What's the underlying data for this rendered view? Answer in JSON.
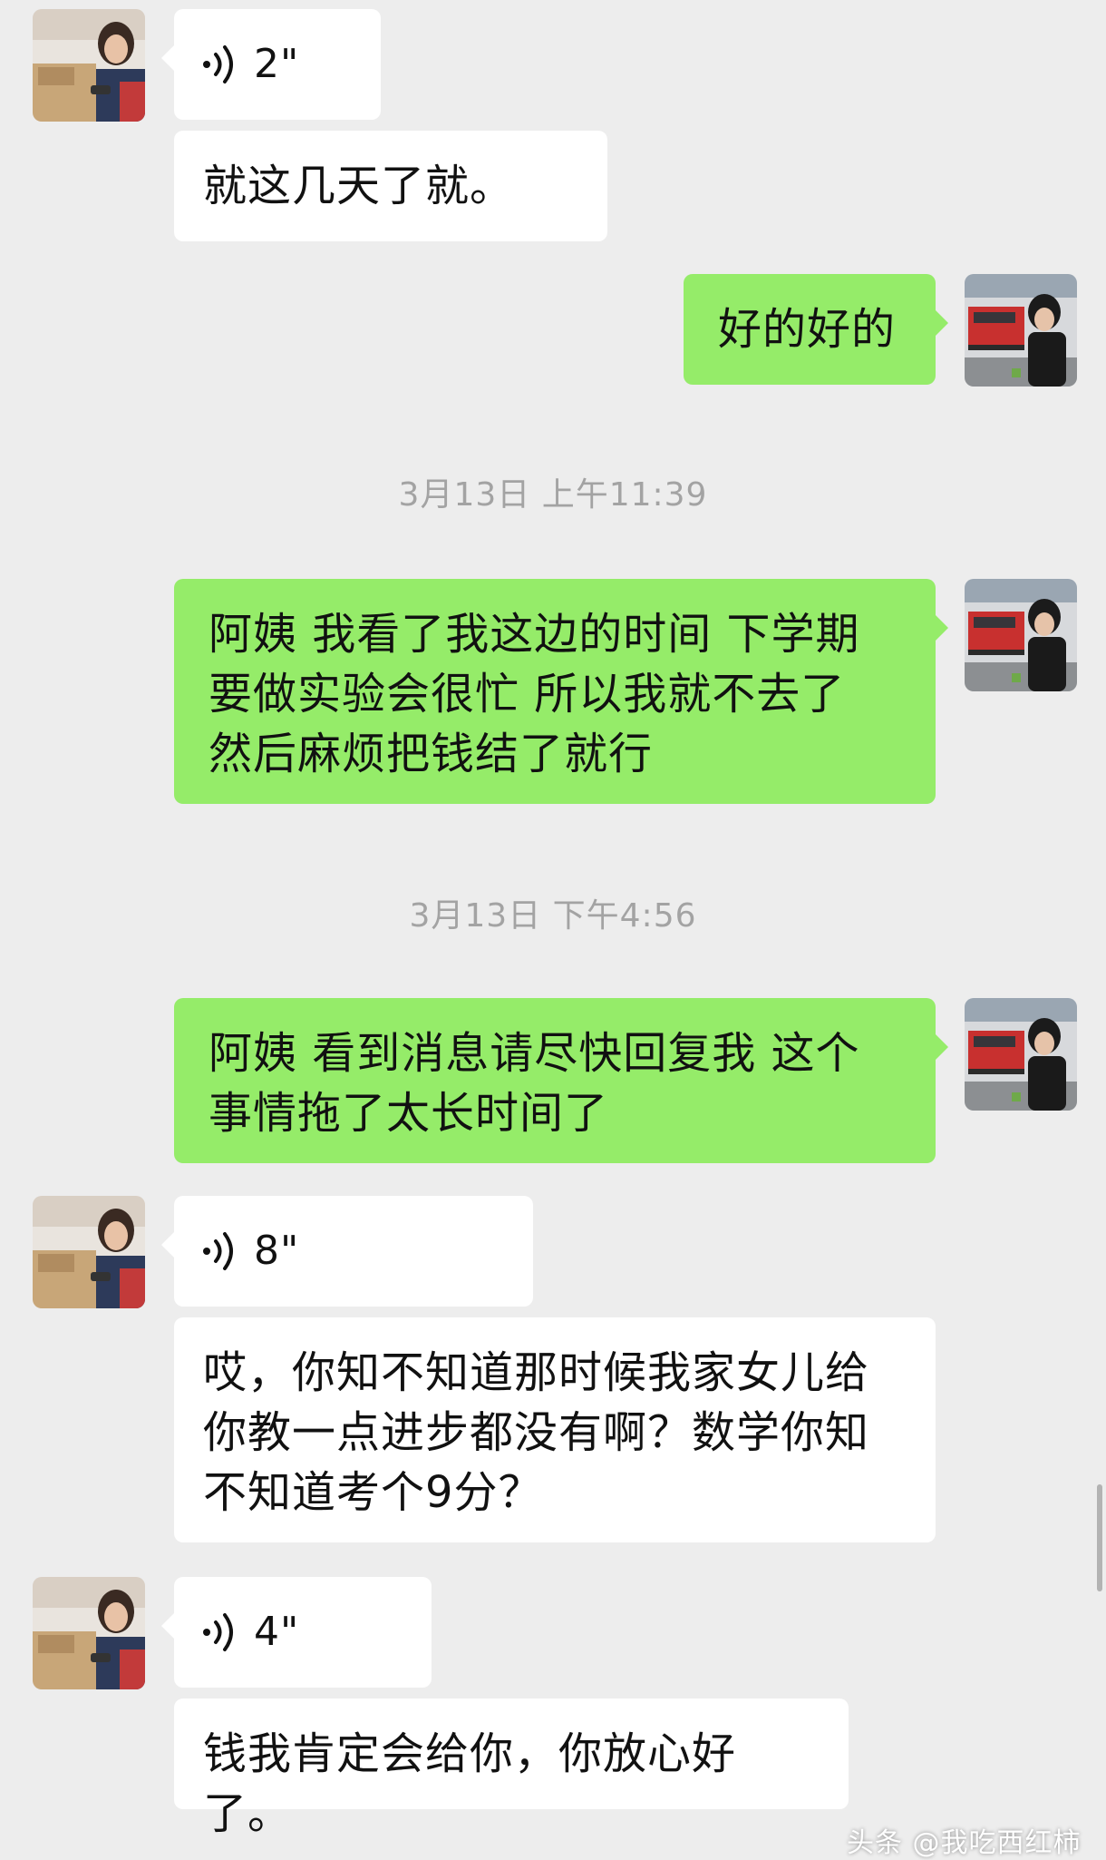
{
  "messages": [
    {
      "type": "voice",
      "duration": "2\""
    },
    {
      "text": "就这几天了就。"
    },
    {
      "text": "好的好的"
    },
    {
      "text": "阿姨 我看了我这边的时间 下学期要做实验会很忙 所以我就不去了 然后麻烦把钱结了就行"
    },
    {
      "text": "阿姨 看到消息请尽快回复我  这个事情拖了太长时间了"
    },
    {
      "type": "voice",
      "duration": "8\""
    },
    {
      "text": "哎，你知不知道那时候我家女儿给你教一点进步都没有啊？数学你知不知道考个9分？"
    },
    {
      "type": "voice",
      "duration": "4\""
    },
    {
      "text": "钱我肯定会给你，你放心好了。"
    }
  ],
  "timestamps": [
    "3月13日 上午11:39",
    "3月13日 下午4:56"
  ],
  "watermark": "头条 @我吃西红柿",
  "colors": {
    "background": "#ededed",
    "bubble_incoming": "#ffffff",
    "bubble_outgoing": "#95ec69",
    "timestamp": "#a3a3a3"
  },
  "icons": {
    "voice": "voice-wave-icon"
  }
}
